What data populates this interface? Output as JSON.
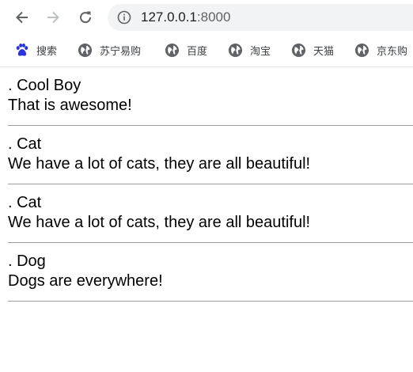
{
  "browser": {
    "url_host": "127.0.0.1",
    "url_port": ":8000",
    "nav_icons": [
      "back-arrow-icon",
      "forward-arrow-icon",
      "reload-icon",
      "info-icon"
    ],
    "bookmarks": [
      {
        "label": "搜索",
        "icon": "baidu-paw-icon"
      },
      {
        "label": "苏宁易购",
        "icon": "globe-icon"
      },
      {
        "label": "百度",
        "icon": "globe-icon"
      },
      {
        "label": "淘宝",
        "icon": "globe-icon"
      },
      {
        "label": "天猫",
        "icon": "globe-icon"
      },
      {
        "label": "京东购",
        "icon": "globe-icon"
      }
    ]
  },
  "posts": [
    {
      "title": ". Cool Boy",
      "body": "That is awesome!"
    },
    {
      "title": ". Cat",
      "body": "We have a lot of cats, they are all beautiful!"
    },
    {
      "title": ". Cat",
      "body": "We have a lot of cats, they are all beautiful!"
    },
    {
      "title": ". Dog",
      "body": "Dogs are everywhere!"
    }
  ],
  "colors": {
    "omnibox_bg": "#f1f3f4",
    "icon_gray": "#5f6368",
    "divider": "#9e9e9e",
    "baidu_blue": "#2932e1"
  }
}
